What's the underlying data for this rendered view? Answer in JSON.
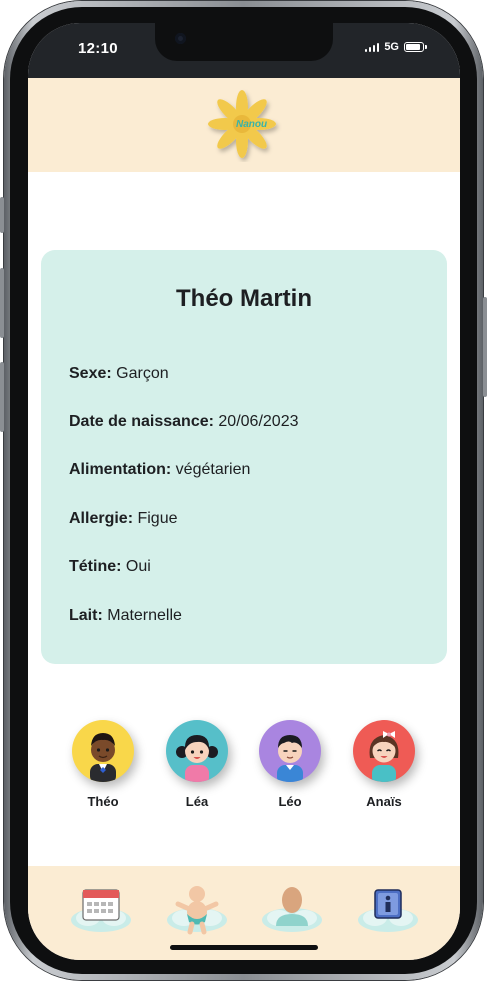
{
  "status_bar": {
    "time": "12:10",
    "network": "5G"
  },
  "app": {
    "logo_text": "Nanou",
    "colors": {
      "header_bg": "#fbecd3",
      "card_bg": "#d5f0ea",
      "logo_petal": "#f2c94c",
      "logo_text": "#39b3a9"
    }
  },
  "profile": {
    "name": "Théo Martin",
    "fields": [
      {
        "label": "Sexe:",
        "value": "Garçon"
      },
      {
        "label": "Date de naissance:",
        "value": "20/06/2023"
      },
      {
        "label": "Alimentation:",
        "value": "végétarien"
      },
      {
        "label": "Allergie:",
        "value": "Figue"
      },
      {
        "label": "Tétine:",
        "value": "Oui"
      },
      {
        "label": "Lait:",
        "value": "Maternelle"
      }
    ]
  },
  "children": [
    {
      "name": "Théo",
      "bg": "#f9d74a",
      "icon": "boy-avatar-icon"
    },
    {
      "name": "Léa",
      "bg": "#56bfc9",
      "icon": "girl-avatar-icon"
    },
    {
      "name": "Léo",
      "bg": "#a985e0",
      "icon": "boy-avatar-icon"
    },
    {
      "name": "Anaïs",
      "bg": "#ef5b55",
      "icon": "girl-avatar-icon"
    }
  ],
  "bottom_nav": [
    {
      "icon": "calendar-icon"
    },
    {
      "icon": "baby-icon"
    },
    {
      "icon": "profile-icon"
    },
    {
      "icon": "info-icon"
    }
  ]
}
